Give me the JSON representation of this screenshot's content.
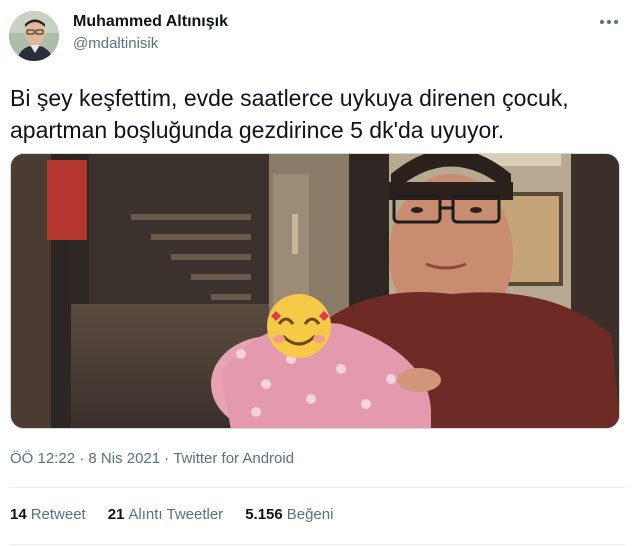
{
  "author": {
    "display_name": "Muhammed Altınışık",
    "handle": "@mdaltinisik",
    "avatar_icon": "user-avatar"
  },
  "tweet": {
    "text_line1": "Bi şey keşfettim, evde saatlerce uykuya direnen çocuk,",
    "text_line2": "apartman boşluğunda gezdirince 5 dk'da uyuyor.",
    "media_description_icon": "photo",
    "emoji_icon": "smiling-face-with-hearts-emoji"
  },
  "meta": {
    "time": "ÖÖ 12:22",
    "separator": "·",
    "date": "8 Nis 2021",
    "source": "Twitter for Android"
  },
  "stats": {
    "retweets_count": "14",
    "retweets_label": "Retweet",
    "quotes_count": "21",
    "quotes_label": "Alıntı Tweetler",
    "likes_count": "5.156",
    "likes_label": "Beğeni"
  },
  "colors": {
    "text_primary": "#0f1419",
    "text_secondary": "#5b7083",
    "divider": "#ebeef0",
    "shirt": "#6e2a24",
    "blanket": "#e7a3b3"
  }
}
